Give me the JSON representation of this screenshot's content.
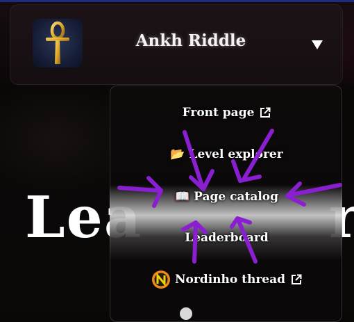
{
  "header": {
    "title": "Ankh Riddle",
    "logo_icon": "ankh-icon",
    "menu_toggle_icon": "chevron-down-icon"
  },
  "hero": {
    "title_start": "Lea",
    "title_end": "r"
  },
  "menu": {
    "items": [
      {
        "label": "Front page",
        "icon": null,
        "external": true
      },
      {
        "label": "Level explorer",
        "icon": "folder-open-icon",
        "icon_glyph": "📂",
        "external": false
      },
      {
        "label": "Page catalog",
        "icon": "open-book-icon",
        "icon_glyph": "📖",
        "external": false
      },
      {
        "label": "Leaderboard",
        "icon": null,
        "external": false
      },
      {
        "label": "Nordinho thread",
        "icon": "nordinho-icon",
        "external": true
      }
    ]
  },
  "annotation": {
    "color": "#8a1fd1",
    "arrows": 6,
    "target": "Page catalog"
  },
  "colors": {
    "background": "#0a0707",
    "header": "#1c1316",
    "accent_top": "#1f2a80",
    "logo_gold": "#e3b53a"
  }
}
